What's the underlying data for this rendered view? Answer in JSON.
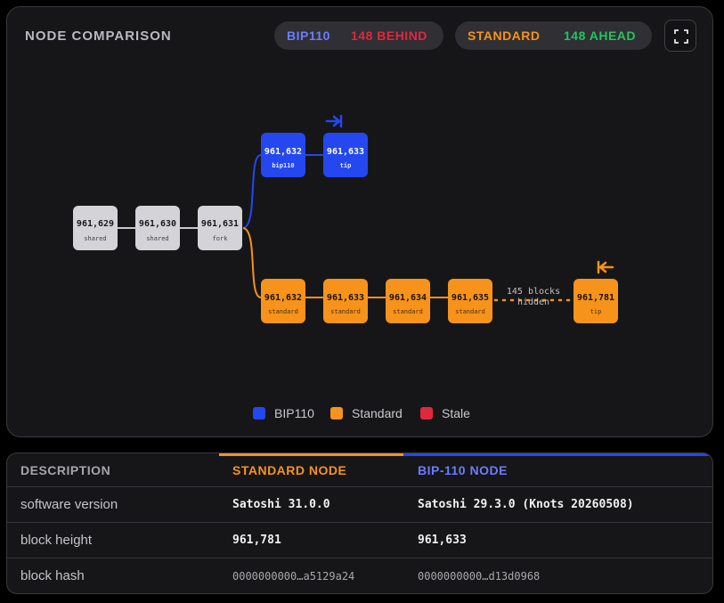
{
  "header": {
    "title": "NODE COMPARISON",
    "bip_pill": {
      "name": "BIP110",
      "status": "148 BEHIND"
    },
    "std_pill": {
      "name": "STANDARD",
      "status": "148 AHEAD"
    }
  },
  "colors": {
    "bip110": "#2447f0",
    "standard": "#f7931a",
    "shared": "#d4d4d8",
    "stale": "#e0283c",
    "behind": "#e0283c",
    "ahead": "#22c55e",
    "bip_label": "#6a7dff"
  },
  "chain": {
    "shared": [
      {
        "height": "961,629",
        "tag": "shared"
      },
      {
        "height": "961,630",
        "tag": "shared"
      },
      {
        "height": "961,631",
        "tag": "fork"
      }
    ],
    "bip110": [
      {
        "height": "961,632",
        "tag": "bip110"
      },
      {
        "height": "961,633",
        "tag": "tip"
      }
    ],
    "standard": [
      {
        "height": "961,632",
        "tag": "standard"
      },
      {
        "height": "961,633",
        "tag": "standard"
      },
      {
        "height": "961,634",
        "tag": "standard"
      },
      {
        "height": "961,635",
        "tag": "standard"
      },
      {
        "height": "961,781",
        "tag": "tip"
      }
    ],
    "hidden_label_1": "145 blocks",
    "hidden_label_2": "hidden"
  },
  "legend": [
    {
      "label": "BIP110",
      "color": "#2447f0"
    },
    {
      "label": "Standard",
      "color": "#f7931a"
    },
    {
      "label": "Stale",
      "color": "#e0283c"
    }
  ],
  "table": {
    "headers": {
      "description": "DESCRIPTION",
      "standard": "STANDARD NODE",
      "bip": "BIP-110 NODE"
    },
    "rows": [
      {
        "label": "software version",
        "standard": "Satoshi 31.0.0",
        "bip": "Satoshi 29.3.0 (Knots 20260508)"
      },
      {
        "label": "block height",
        "standard": "961,781",
        "bip": "961,633"
      },
      {
        "label": "block hash",
        "standard": "0000000000…a5129a24",
        "bip": "0000000000…d13d0968"
      }
    ]
  }
}
